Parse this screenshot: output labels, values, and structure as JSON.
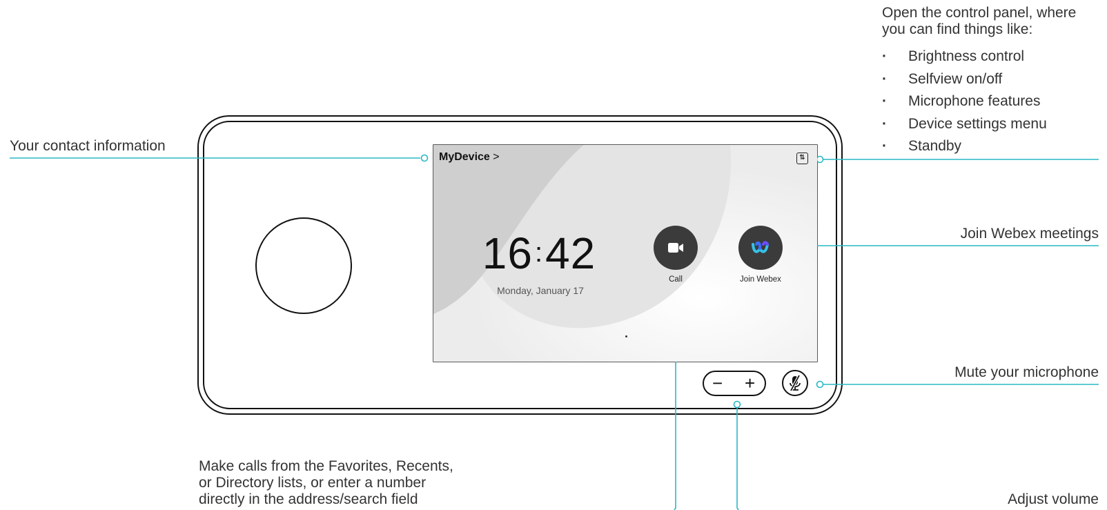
{
  "callouts": {
    "contact": "Your contact information",
    "control_panel_intro": [
      "Open the control panel, where",
      "you can find things like:"
    ],
    "control_panel_items": [
      "Brightness control",
      "Selfview on/off",
      "Microphone features",
      "Device settings menu",
      "Standby"
    ],
    "join_webex": "Join Webex meetings",
    "mute": "Mute your microphone",
    "calls": [
      "Make calls from the Favorites, Recents,",
      "or Directory lists, or enter a number",
      "directly in the address/search field"
    ],
    "volume": "Adjust volume"
  },
  "screen": {
    "device_name": "MyDevice",
    "device_chevron": ">",
    "control_panel_glyph": "⇅",
    "time_hours": "16",
    "time_minutes": "42",
    "time_separator": ":",
    "date": "Monday, January 17",
    "call_label": "Call",
    "webex_label": "Join Webex"
  },
  "hardware": {
    "volume_minus": "−",
    "volume_plus": "+"
  },
  "icons": {
    "camera_lens": "camera-lens-icon",
    "control_panel": "control-panel-icon",
    "call": "video-camera-icon",
    "webex": "webex-logo-icon",
    "mute": "microphone-muted-icon"
  },
  "colors": {
    "leader": "#29b8c4",
    "device_outline": "#111111",
    "button_dark": "#3b3b3b"
  }
}
